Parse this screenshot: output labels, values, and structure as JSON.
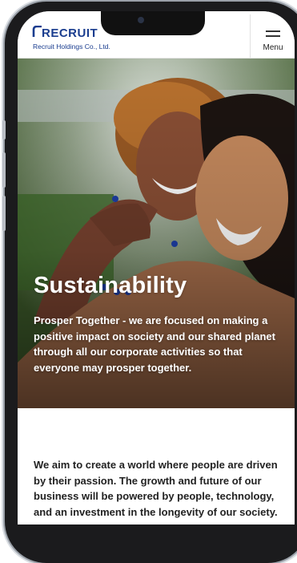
{
  "header": {
    "logo_word": "RECRUIT",
    "logo_subtitle": "Recruit Holdings Co., Ltd.",
    "menu_label": "Menu"
  },
  "hero": {
    "title": "Sustainability",
    "body": "Prosper Together - we are focused on making a positive impact on society and our shared planet through all our corporate activities so that everyone may prosper together."
  },
  "intro": {
    "text": "We aim to create a world where people are driven by their passion. The growth and future of our business will be powered by people, technology, and an investment in the longevity of our society."
  },
  "colors": {
    "brand_blue": "#1a3d8f",
    "text_dark": "#222222",
    "hero_text": "#ffffff"
  },
  "icons": [
    "recruit-logo-icon",
    "hamburger-menu-icon"
  ]
}
